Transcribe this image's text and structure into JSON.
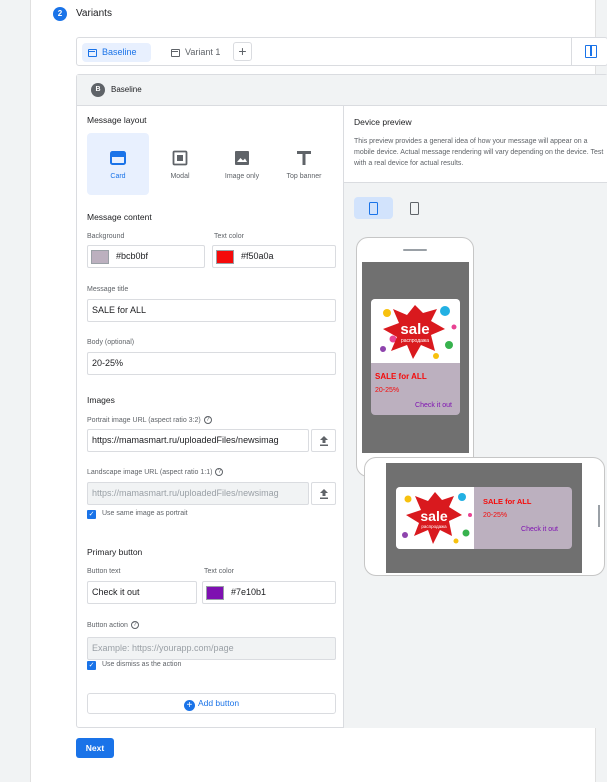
{
  "step": {
    "number": "2",
    "title": "Variants"
  },
  "tabs": [
    {
      "label": "Baseline"
    },
    {
      "label": "Variant 1"
    }
  ],
  "add_tab_label": "+",
  "variant": {
    "badge": "B",
    "name": "Baseline"
  },
  "layout": {
    "title": "Message layout",
    "options": [
      {
        "label": "Card",
        "icon": "card-layout-icon",
        "selected": true
      },
      {
        "label": "Modal",
        "icon": "modal-layout-icon"
      },
      {
        "label": "Image only",
        "icon": "image-only-icon"
      },
      {
        "label": "Top banner",
        "icon": "top-banner-icon"
      }
    ]
  },
  "content": {
    "title": "Message content",
    "background_label": "Background",
    "background_value": "#bcb0bf",
    "text_color_label": "Text color",
    "text_color_value": "#f50a0a",
    "title_label": "Message title",
    "title_value": "SALE for ALL",
    "body_label": "Body (optional)",
    "body_value": "20-25%"
  },
  "images": {
    "title": "Images",
    "portrait_label": "Portrait image URL (aspect ratio 3:2)",
    "portrait_value": "https://mamasmart.ru/uploadedFiles/newsimag",
    "landscape_label": "Landscape image URL (aspect ratio 1:1)",
    "landscape_value": "https://mamasmart.ru/uploadedFiles/newsimag",
    "same_image_label": "Use same image as portrait"
  },
  "primary_button": {
    "title": "Primary button",
    "text_label": "Button text",
    "text_value": "Check it out",
    "color_label": "Text color",
    "color_value": "#7e10b1",
    "action_label": "Button action",
    "action_placeholder": "Example: https://yourapp.com/page",
    "dismiss_label": "Use dismiss as the action"
  },
  "add_button_label": "Add button",
  "preview": {
    "title": "Device preview",
    "description": "This preview provides a general idea of how your message will appear on a mobile device. Actual message rendering will vary depending on the device. Test with a real device for actual results.",
    "message_title": "SALE for ALL",
    "message_body": "20-25%",
    "message_button": "Check it out",
    "image_text": "sale",
    "image_subtext": "распродажа"
  },
  "next_label": "Next",
  "colors": {
    "accent": "#1a73e8",
    "background": "#bcb0bf",
    "text": "#f50a0a",
    "button_text": "#7e10b1"
  }
}
